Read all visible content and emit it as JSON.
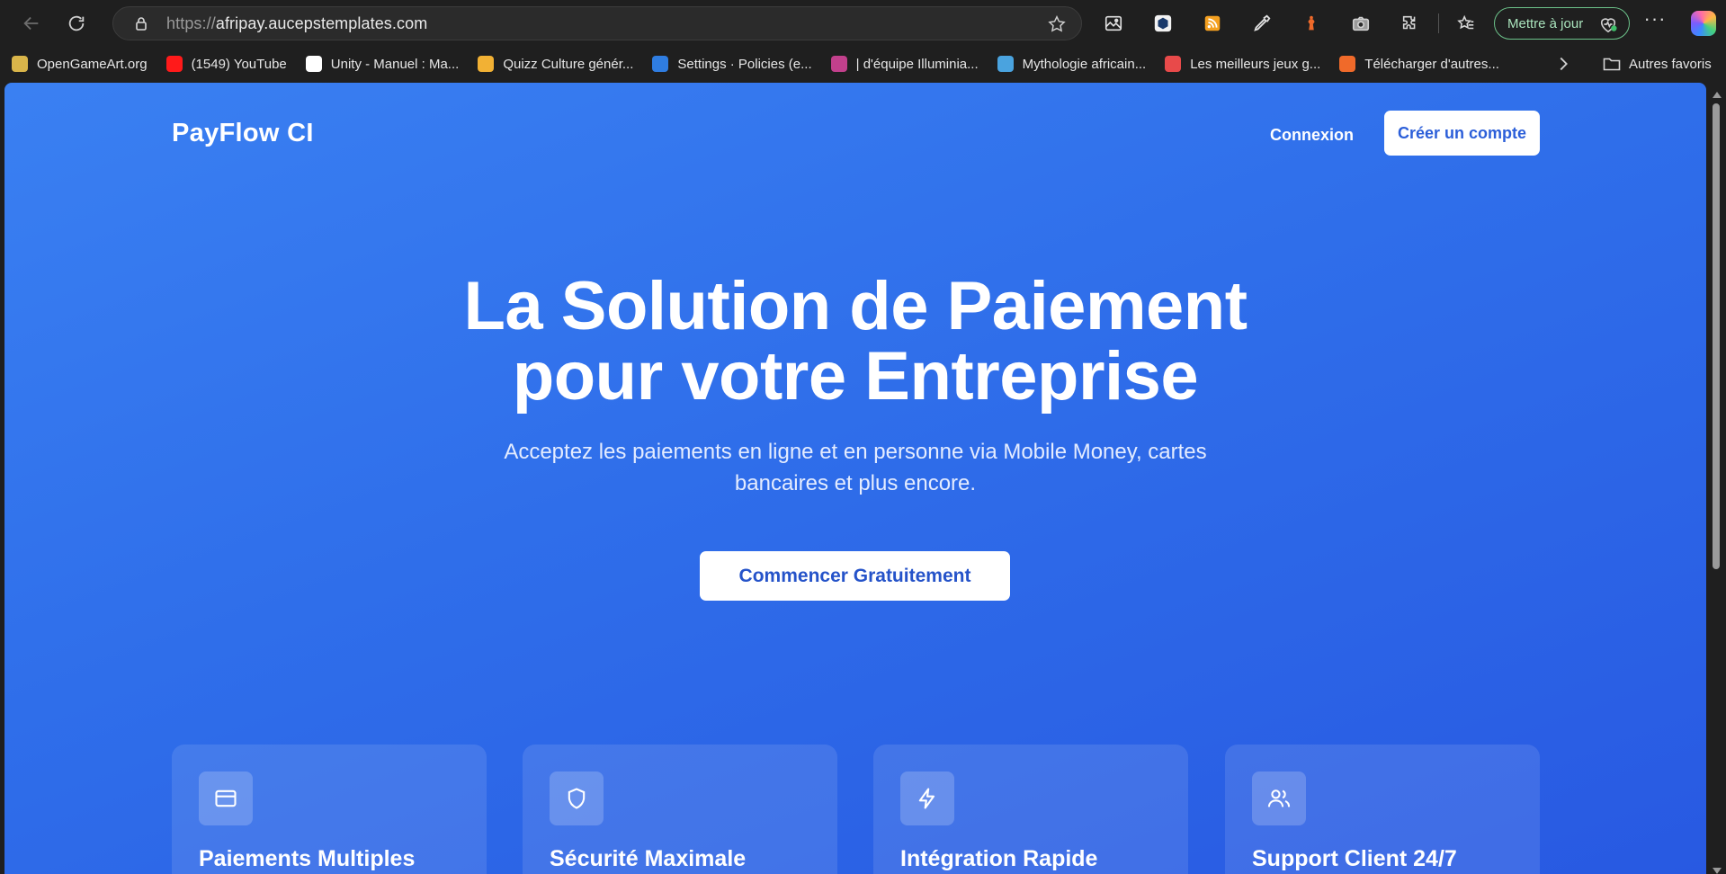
{
  "browser": {
    "url_prefix": "https://",
    "url_host": "afripay.aucepstemplates.com",
    "update_label": "Mettre à jour",
    "more_label": "···",
    "bookmarks": [
      {
        "label": "OpenGameArt.org",
        "color": "#d9b54a"
      },
      {
        "label": "(1549) YouTube",
        "color": "#ff1a1a"
      },
      {
        "label": "Unity - Manuel : Ma...",
        "color": "#ffffff"
      },
      {
        "label": "Quizz Culture génér...",
        "color": "#f2b134"
      },
      {
        "label": "Settings · Policies (e...",
        "color": "#2f7de1"
      },
      {
        "label": "| d'équipe Illuminia...",
        "color": "#c2408c"
      },
      {
        "label": "Mythologie africain...",
        "color": "#4aa3df"
      },
      {
        "label": "Les meilleurs jeux g...",
        "color": "#e84a4a"
      },
      {
        "label": "Télécharger d'autres...",
        "color": "#f06a2a"
      }
    ],
    "other_favorites": "Autres favoris"
  },
  "site": {
    "logo": "PayFlow CI",
    "login": "Connexion",
    "signup": "Créer un compte"
  },
  "hero": {
    "title_line1": "La Solution de Paiement",
    "title_line2": "pour votre Entreprise",
    "subtitle": "Acceptez les paiements en ligne et en personne via Mobile Money, cartes bancaires et plus encore.",
    "cta": "Commencer Gratuitement"
  },
  "features": [
    {
      "title": "Paiements Multiples",
      "icon": "credit-card-icon"
    },
    {
      "title": "Sécurité Maximale",
      "icon": "shield-icon"
    },
    {
      "title": "Intégration Rapide",
      "icon": "lightning-icon"
    },
    {
      "title": "Support Client 24/7",
      "icon": "users-icon"
    }
  ],
  "colors": {
    "accent": "#2c5fd9",
    "update_green": "#6cc28a"
  }
}
